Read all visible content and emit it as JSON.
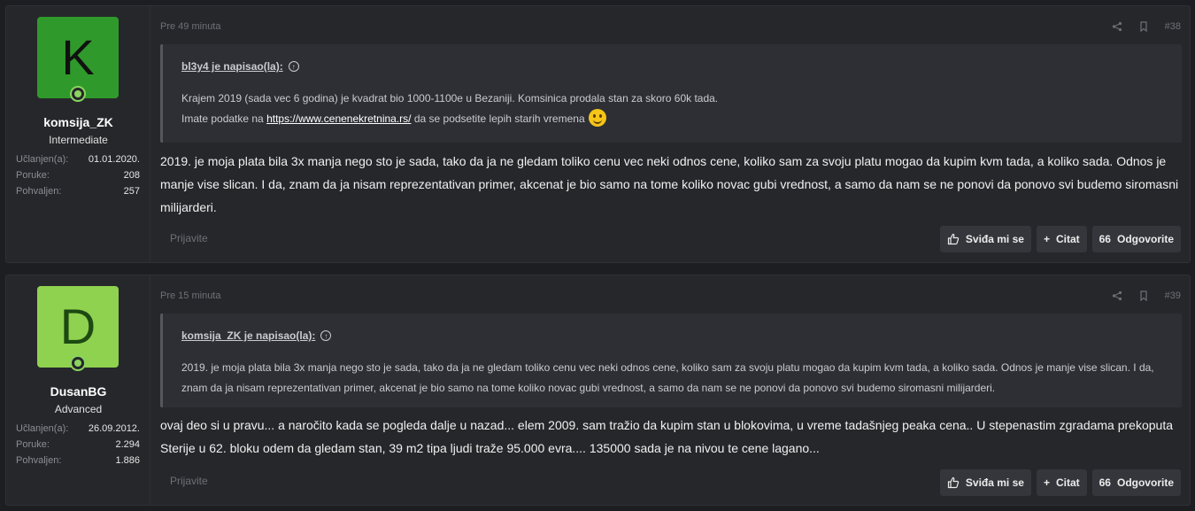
{
  "posts": [
    {
      "avatar_letter": "K",
      "username": "komsija_ZK",
      "user_title": "Intermediate",
      "stats": [
        {
          "label": "Učlanjen(a):",
          "value": "01.01.2020."
        },
        {
          "label": "Poruke:",
          "value": "208"
        },
        {
          "label": "Pohvaljen:",
          "value": "257"
        }
      ],
      "time": "Pre 49 minuta",
      "post_number": "#38",
      "quote": {
        "author": "bl3y4 je napisao(la):",
        "line1": "Krajem 2019 (sada vec 6 godina) je kvadrat bio 1000-1100e u Bezaniji. Komsinica prodala stan za skoro 60k tada.",
        "line2_prefix": "Imate podatke na ",
        "line2_link": "https://www.cenenekretnina.rs/",
        "line2_suffix": " da se podsetite lepih starih vremena"
      },
      "message": "2019. je moja plata bila 3x manja nego sto je sada, tako da ja ne gledam toliko cenu vec neki odnos cene, koliko sam za svoju platu mogao da kupim kvm tada, a koliko sada. Odnos je manje vise slican. I da, znam da ja nisam reprezentativan primer, akcenat je bio samo na tome koliko novac gubi vrednost, a samo da nam se ne ponovi da ponovo svi budemo siromasni milijarderi.",
      "report": "Prijavite",
      "like": "Sviđa mi se",
      "quote_btn": "Citat",
      "reply": "Odgovorite"
    },
    {
      "avatar_letter": "D",
      "username": "DusanBG",
      "user_title": "Advanced",
      "stats": [
        {
          "label": "Učlanjen(a):",
          "value": "26.09.2012."
        },
        {
          "label": "Poruke:",
          "value": "2.294"
        },
        {
          "label": "Pohvaljen:",
          "value": "1.886"
        }
      ],
      "time": "Pre 15 minuta",
      "post_number": "#39",
      "quote": {
        "author": "komsija_ZK je napisao(la):",
        "text": "2019. je moja plata bila 3x manja nego sto je sada, tako da ja ne gledam toliko cenu vec neki odnos cene, koliko sam za svoju platu mogao da kupim kvm tada, a koliko sada. Odnos je manje vise slican. I da, znam da ja nisam reprezentativan primer, akcenat je bio samo na tome koliko novac gubi vrednost, a samo da nam se ne ponovi da ponovo svi budemo siromasni milijarderi."
      },
      "message": "ovaj deo si u pravu... a naročito kada se pogleda dalje u nazad... elem 2009. sam tražio da kupim stan u blokovima, u vreme tadašnjeg peaka cena.. U stepenastim zgradama prekoputa Sterije u 62. bloku odem da gledam stan, 39 m2 tipa ljudi traže 95.000 evra.... 135000 sada je na nivou te cene lagano...",
      "report": "Prijavite",
      "like": "Sviđa mi se",
      "quote_btn": "Citat",
      "reply": "Odgovorite"
    }
  ]
}
